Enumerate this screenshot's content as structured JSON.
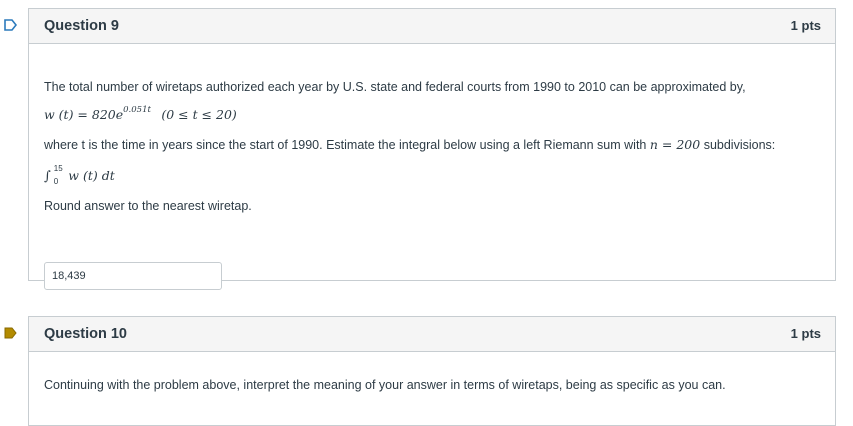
{
  "questions": [
    {
      "title": "Question 9",
      "points": "1 pts",
      "intro": "The total number of wiretaps authorized each year by U.S. state and federal courts from 1990 to 2010 can be approximated by,",
      "formula": {
        "lhs": "w (t) = 820e",
        "exponent": "0.051t",
        "domain": "(0 ≤ t ≤ 20)"
      },
      "where_text": "where t is the time in years since the start of 1990. Estimate the integral below using a left Riemann sum with",
      "n_expr": "n = 200",
      "subdivisions_text": "subdivisions:",
      "integral": {
        "lower": "0",
        "upper": "15",
        "integrand": "w (t) dt"
      },
      "round_text": "Round answer to the nearest wiretap.",
      "answer_value": "18,439"
    },
    {
      "title": "Question 10",
      "points": "1 pts",
      "prompt": "Continuing with the problem above, interpret the meaning of your answer in terms of wiretaps, being as specific as you can."
    }
  ],
  "icons": {
    "q9_flag": "bookmark-outline-icon",
    "q10_flag": "bookmark-filled-icon"
  },
  "colors": {
    "flag_outline": "#2b7abc",
    "flag_filled": "#b38b00",
    "border": "#c7cdd1",
    "header_bg": "#f5f5f5",
    "text": "#2d3b45"
  }
}
